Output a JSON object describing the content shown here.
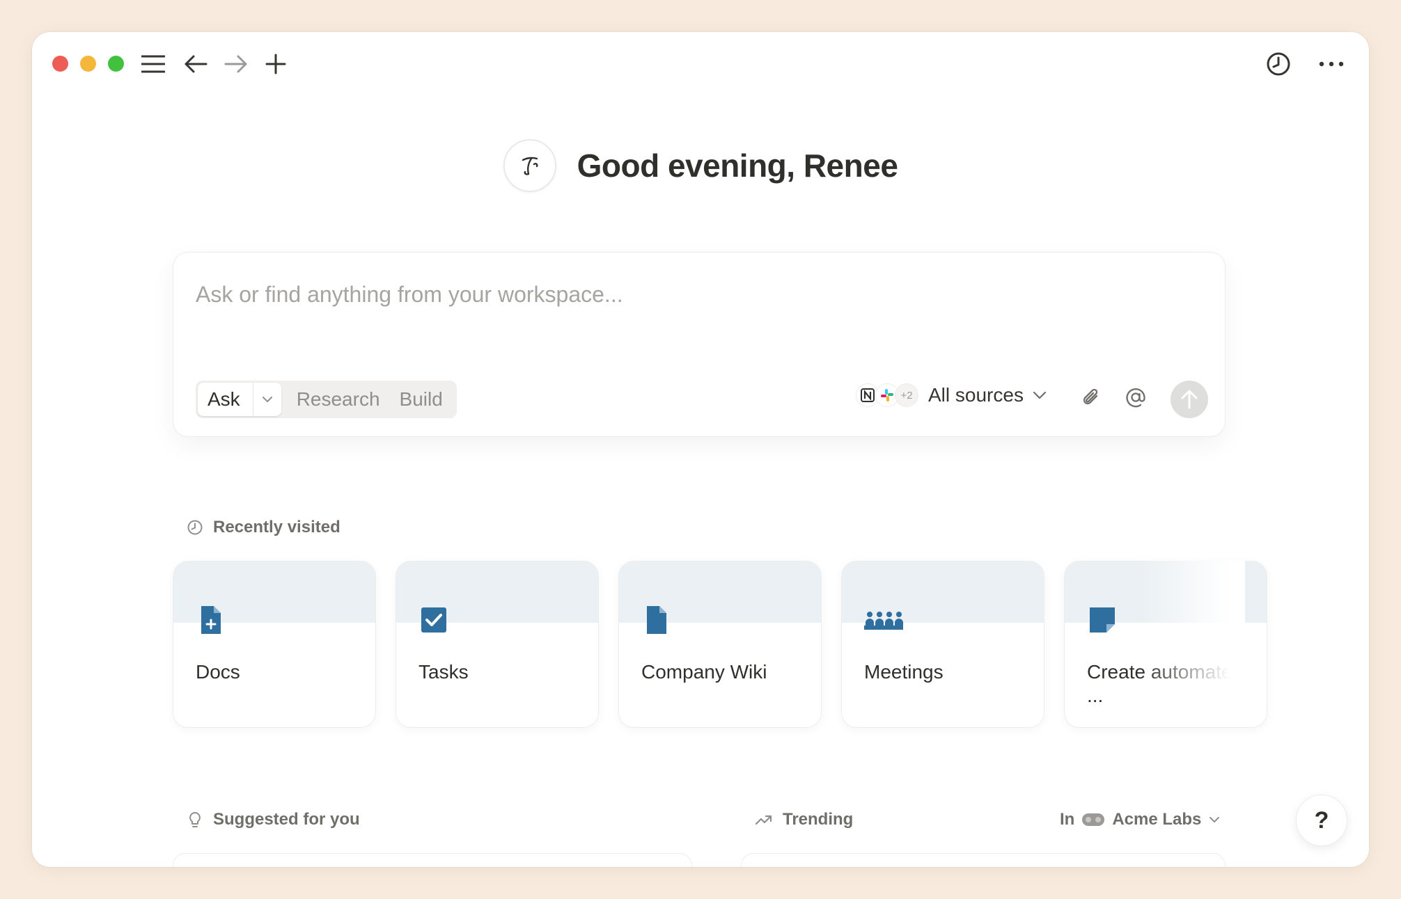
{
  "window": {
    "titlebar": {
      "traffic_lights": {
        "close": "#ee5d55",
        "minimize": "#f5b73a",
        "zoom": "#42c13f"
      },
      "left_icons": [
        "menu-icon",
        "arrow-left-icon",
        "arrow-right-icon",
        "plus-icon"
      ],
      "right_icons": [
        "clock-icon",
        "more-horizontal-icon"
      ]
    },
    "greeting": {
      "avatar_icon": "signature-avatar-icon",
      "text": "Good evening, Renee"
    },
    "ask": {
      "placeholder": "Ask or find anything from your workspace...",
      "value": "",
      "modes": {
        "selected": "Ask",
        "others": [
          "Research",
          "Build"
        ]
      },
      "sources": {
        "icons": [
          "notion-icon",
          "slack-icon"
        ],
        "extra_count": "+2",
        "label": "All sources"
      },
      "actions": [
        "paperclip-icon",
        "at-icon",
        "send-arrow-icon"
      ]
    },
    "recently_visited": {
      "title": "Recently visited",
      "accent": "#2f6f9f",
      "items": [
        {
          "title": "Docs",
          "icon": "doc-plus-icon"
        },
        {
          "title": "Tasks",
          "icon": "checkbox-icon"
        },
        {
          "title": "Company Wiki",
          "icon": "page-icon"
        },
        {
          "title": "Meetings",
          "icon": "people-icon"
        },
        {
          "title": "Create automated ...",
          "icon": "sticky-note-icon"
        }
      ]
    },
    "suggested": {
      "title": "Suggested for you"
    },
    "trending": {
      "title": "Trending",
      "scope_prefix": "In",
      "workspace": "Acme Labs"
    },
    "help": {
      "label": "?"
    }
  }
}
